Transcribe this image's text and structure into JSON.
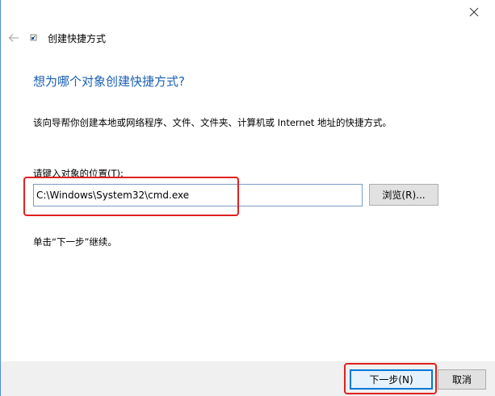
{
  "window": {
    "close_glyph": "✕",
    "accent_color": "#1a5fb4"
  },
  "titlebar": {
    "back_glyph": "←",
    "title": "创建快捷方式"
  },
  "main": {
    "heading": "想为哪个对象创建快捷方式?",
    "description": "该向导帮你创建本地或网络程序、文件、文件夹、计算机或 Internet 地址的快捷方式。",
    "location_label": "请键入对象的位置(T):",
    "location_value": "C:\\Windows\\System32\\cmd.exe",
    "browse_label": "浏览(R)...",
    "hint": "单击“下一步”继续。"
  },
  "footer": {
    "next_label": "下一步(N)",
    "cancel_label": "取消"
  },
  "annotations": {
    "highlight_color": "#e02020"
  }
}
